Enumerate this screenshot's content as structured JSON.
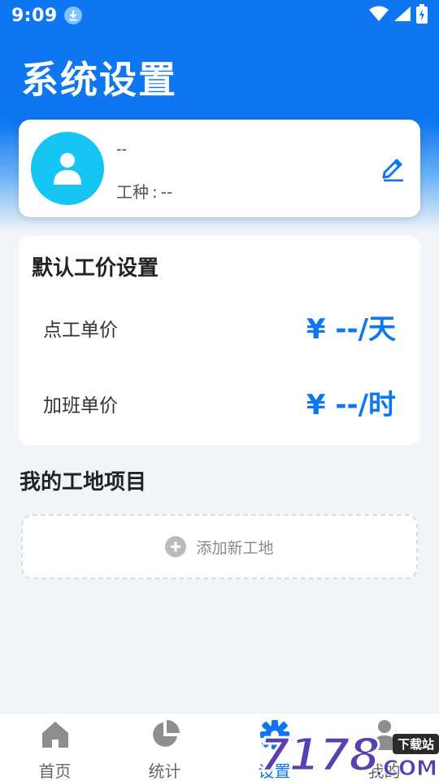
{
  "status_bar": {
    "time": "9:09",
    "download_icon": "download-icon",
    "wifi_icon": "wifi-icon",
    "signal_icon": "signal-icon",
    "battery_icon": "battery-charging-icon"
  },
  "header": {
    "title": "系统设置"
  },
  "profile": {
    "name": "--",
    "role_label": "工种",
    "role_separator": ":",
    "role_value": "--",
    "avatar_icon": "person-icon",
    "edit_icon": "edit-pencil-icon"
  },
  "price_settings": {
    "title": "默认工价设置",
    "rows": [
      {
        "label": "点工单价",
        "value": "¥ --/天"
      },
      {
        "label": "加班单价",
        "value": "¥ --/时"
      }
    ]
  },
  "projects": {
    "title": "我的工地项目",
    "add_label": "添加新工地",
    "add_icon": "plus-circle-icon"
  },
  "bottom_nav": {
    "items": [
      {
        "label": "首页",
        "icon": "home-icon",
        "active": false
      },
      {
        "label": "统计",
        "icon": "pie-chart-icon",
        "active": false
      },
      {
        "label": "设置",
        "icon": "gear-icon",
        "active": true
      },
      {
        "label": "我的",
        "icon": "user-icon",
        "active": false
      }
    ]
  },
  "watermark": {
    "text": "7178",
    "suffix": ".COM",
    "tag": "下载站"
  },
  "colors": {
    "primary": "#0d76f0",
    "avatar": "#15c6f4",
    "background": "#f1f4f8"
  }
}
